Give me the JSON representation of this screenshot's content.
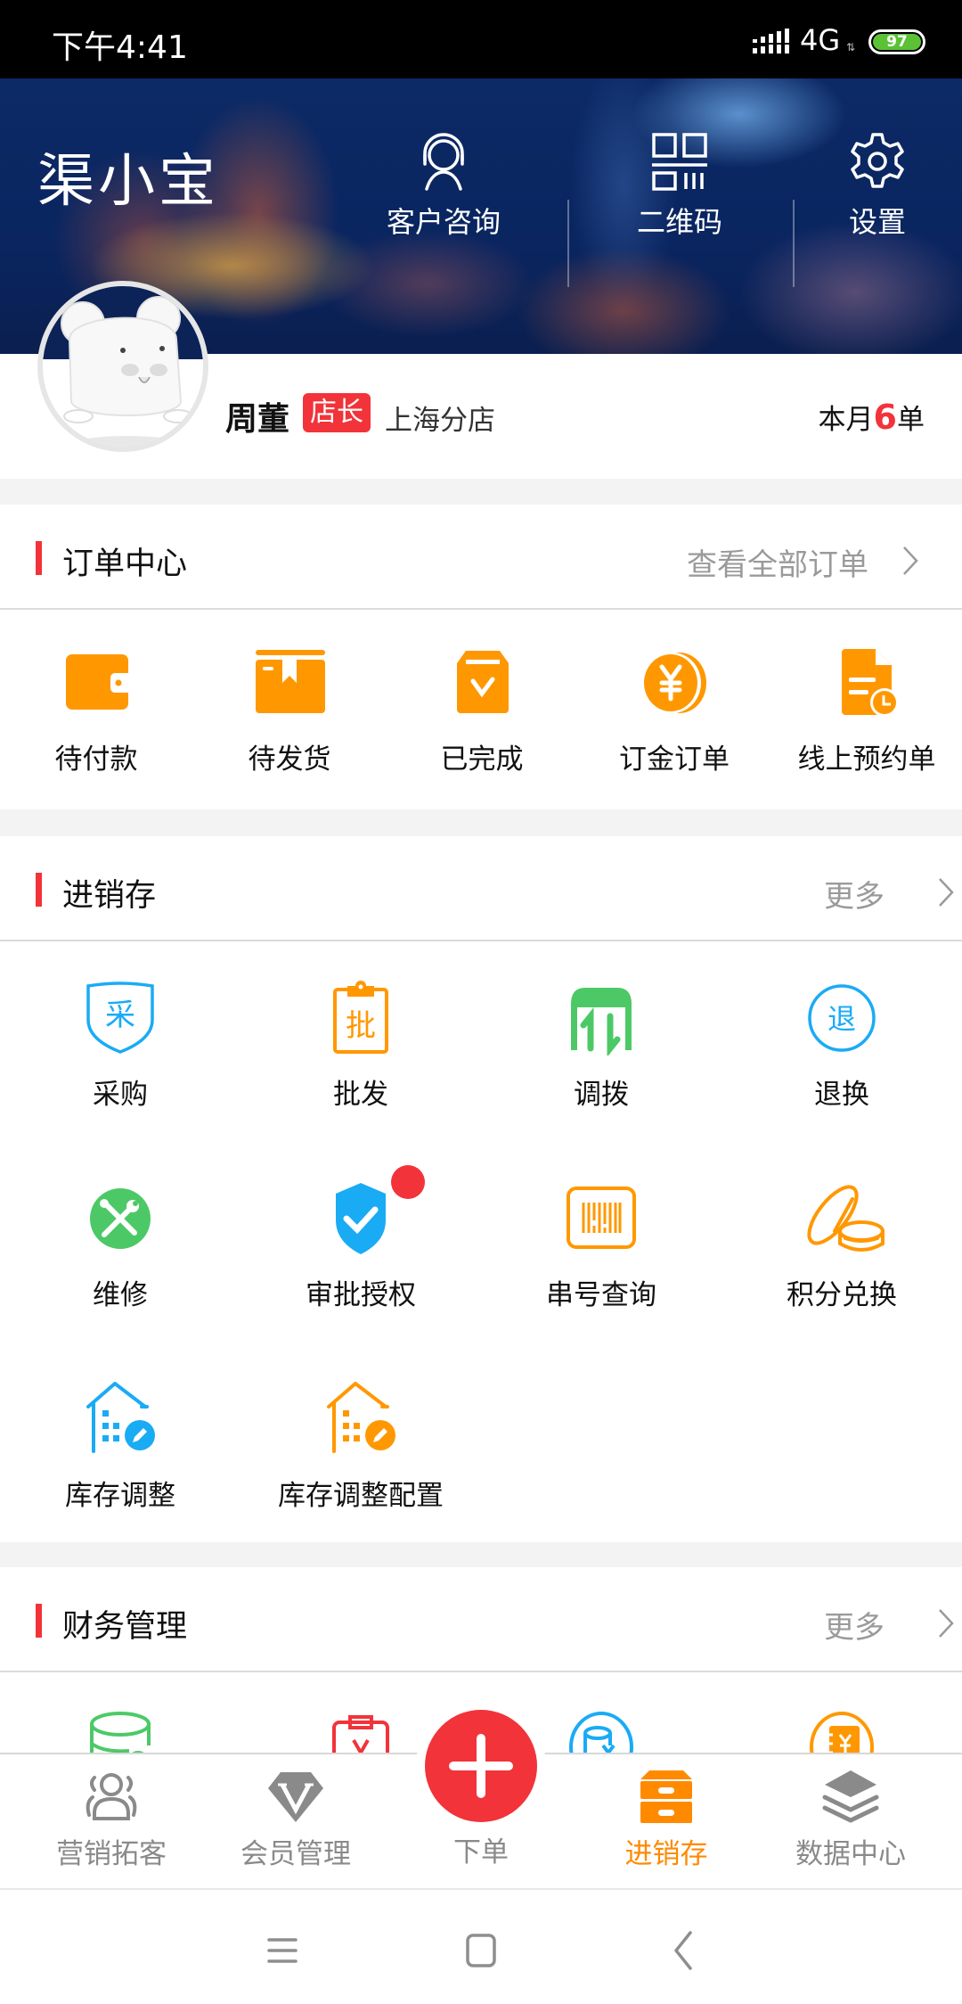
{
  "status_bar": {
    "time": "下午4:41",
    "network": "4G",
    "battery": "97"
  },
  "header": {
    "app_title": "渠小宝",
    "actions": [
      {
        "label": "客户咨询",
        "icon": "headset-icon"
      },
      {
        "label": "二维码",
        "icon": "qr-code-icon"
      },
      {
        "label": "设置",
        "icon": "gear-icon"
      }
    ]
  },
  "profile": {
    "name": "周董",
    "role": "店长",
    "branch": "上海分店",
    "orders_prefix": "本月",
    "orders_count": "6",
    "orders_suffix": "单"
  },
  "colors": {
    "accent_red": "#f2333a",
    "orange": "#ff9800",
    "blue": "#1aabf5",
    "green": "#4cc966",
    "active_tab": "#ff8a00"
  },
  "order_center": {
    "title": "订单中心",
    "more": "查看全部订单",
    "items": [
      {
        "label": "待付款",
        "icon": "wallet-icon"
      },
      {
        "label": "待发货",
        "icon": "package-icon"
      },
      {
        "label": "已完成",
        "icon": "bag-check-icon"
      },
      {
        "label": "订金订单",
        "icon": "yuan-coin-icon"
      },
      {
        "label": "线上预约单",
        "icon": "document-clock-icon"
      }
    ]
  },
  "inventory": {
    "title": "进销存",
    "more": "更多",
    "items": [
      {
        "label": "采购",
        "icon": "purchase-shield-icon",
        "glyph": "采"
      },
      {
        "label": "批发",
        "icon": "clipboard-icon",
        "glyph": "批"
      },
      {
        "label": "调拨",
        "icon": "transfer-icon"
      },
      {
        "label": "退换",
        "icon": "return-circle-icon",
        "glyph": "退"
      },
      {
        "label": "维修",
        "icon": "repair-tools-icon"
      },
      {
        "label": "审批授权",
        "icon": "approval-shield-icon",
        "has_badge": true
      },
      {
        "label": "串号查询",
        "icon": "barcode-icon"
      },
      {
        "label": "积分兑换",
        "icon": "coins-icon"
      },
      {
        "label": "库存调整",
        "icon": "warehouse-edit-icon"
      },
      {
        "label": "库存调整配置",
        "icon": "warehouse-edit-config-icon"
      }
    ]
  },
  "finance": {
    "title": "财务管理",
    "more": "更多",
    "items": [
      {
        "icon": "money-stack-icon"
      },
      {
        "icon": "payment-clipboard-icon"
      },
      {
        "icon": "yuan-database-icon"
      },
      {
        "icon": "ledger-icon"
      }
    ]
  },
  "bottom_nav": {
    "items": [
      {
        "label": "营销拓客",
        "icon": "users-icon",
        "active": false
      },
      {
        "label": "会员管理",
        "icon": "vip-diamond-icon",
        "active": false
      },
      {
        "label": "下单",
        "icon": "plus-icon",
        "active": false
      },
      {
        "label": "进销存",
        "icon": "cabinet-icon",
        "active": true
      },
      {
        "label": "数据中心",
        "icon": "layers-icon",
        "active": false
      }
    ]
  },
  "system_nav": {
    "buttons": [
      "menu",
      "home",
      "back"
    ]
  }
}
